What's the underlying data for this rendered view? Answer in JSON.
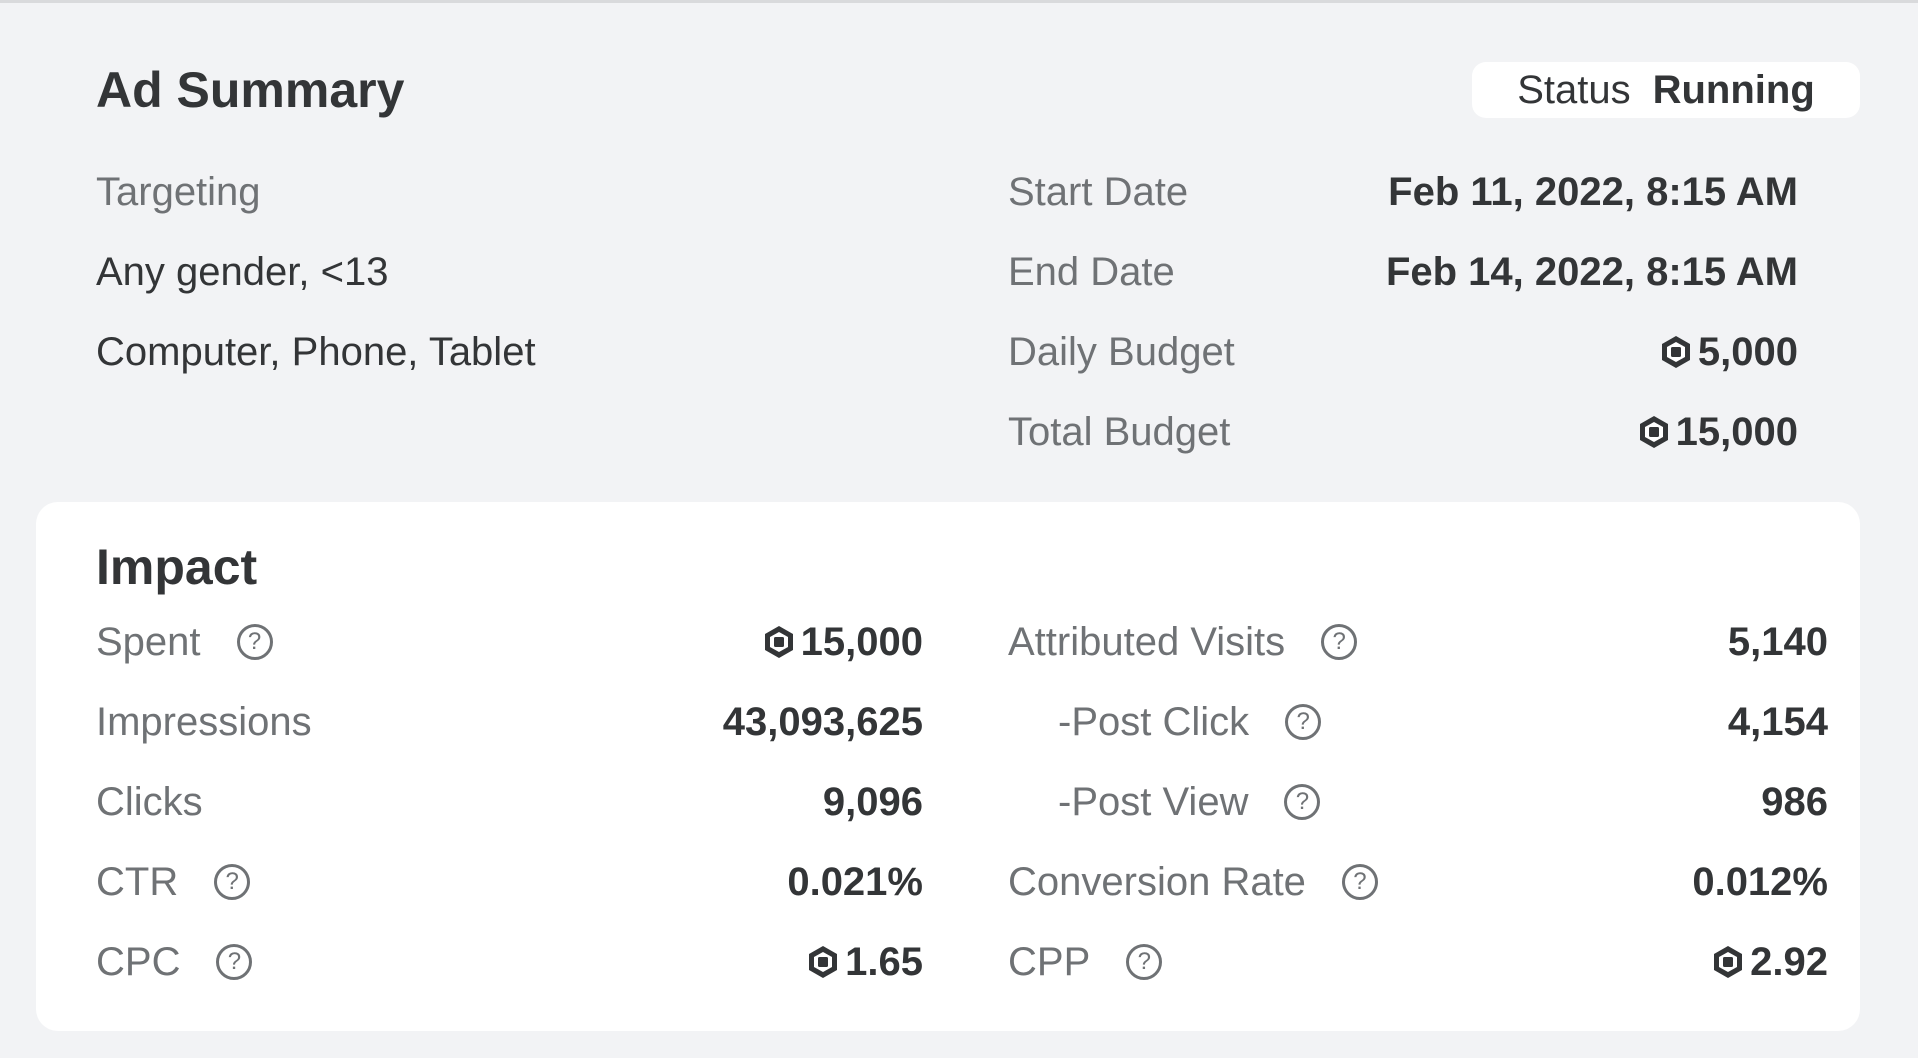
{
  "ad_summary": {
    "title": "Ad Summary",
    "status": {
      "label": "Status",
      "value": "Running"
    },
    "targeting": {
      "label": "Targeting",
      "audience": "Any gender, <13",
      "devices": "Computer, Phone, Tablet"
    },
    "details": [
      {
        "label": "Start Date",
        "value": "Feb 11, 2022, 8:15 AM",
        "currency": false
      },
      {
        "label": "End Date",
        "value": "Feb 14, 2022, 8:15 AM",
        "currency": false
      },
      {
        "label": "Daily Budget",
        "value": "5,000",
        "currency": true
      },
      {
        "label": "Total Budget",
        "value": "15,000",
        "currency": true
      }
    ]
  },
  "impact": {
    "title": "Impact",
    "left_metrics": [
      {
        "label": "Spent",
        "value": "15,000",
        "help": true,
        "currency": true,
        "indent": false
      },
      {
        "label": "Impressions",
        "value": "43,093,625",
        "help": false,
        "currency": false,
        "indent": false
      },
      {
        "label": "Clicks",
        "value": "9,096",
        "help": false,
        "currency": false,
        "indent": false
      },
      {
        "label": "CTR",
        "value": "0.021%",
        "help": true,
        "currency": false,
        "indent": false
      },
      {
        "label": "CPC",
        "value": "1.65",
        "help": true,
        "currency": true,
        "indent": false
      }
    ],
    "right_metrics": [
      {
        "label": "Attributed Visits",
        "value": "5,140",
        "help": true,
        "currency": false,
        "indent": false
      },
      {
        "label": "-Post Click",
        "value": "4,154",
        "help": true,
        "currency": false,
        "indent": true
      },
      {
        "label": "-Post View",
        "value": "986",
        "help": true,
        "currency": false,
        "indent": true
      },
      {
        "label": "Conversion Rate",
        "value": "0.012%",
        "help": true,
        "currency": false,
        "indent": false
      },
      {
        "label": "CPP",
        "value": "2.92",
        "help": true,
        "currency": true,
        "indent": false
      }
    ]
  },
  "icons": {
    "help": "question-circle-icon",
    "currency": "robux-icon",
    "help_glyph": "?"
  },
  "colors": {
    "background": "#f2f3f5",
    "card": "#ffffff",
    "text_primary": "#333537",
    "text_secondary": "#6f7275"
  }
}
